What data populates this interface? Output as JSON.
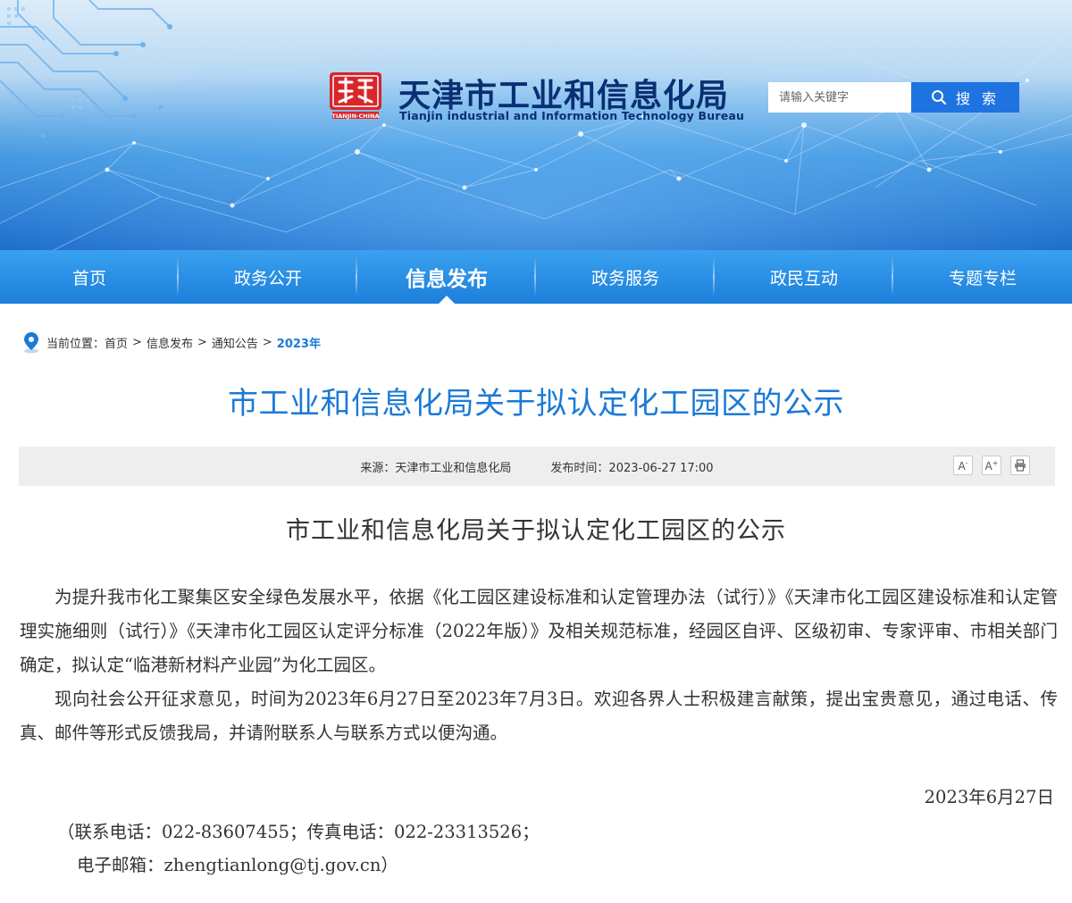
{
  "header": {
    "site_title": "天津市工业和信息化局",
    "site_subtitle": "Tianjin industrial and Information Technology Bureau",
    "logo_text": "天津",
    "logo_caption": "TIANJIN·CHINA",
    "search_placeholder": "请输入关键字",
    "search_button": "搜 索"
  },
  "nav": {
    "items": [
      {
        "label": "首页"
      },
      {
        "label": "政务公开"
      },
      {
        "label": "信息发布"
      },
      {
        "label": "政务服务"
      },
      {
        "label": "政民互动"
      },
      {
        "label": "专题专栏"
      }
    ],
    "active_label": "信息发布"
  },
  "breadcrumb": {
    "prefix": "当前位置：",
    "items": [
      "首页",
      "信息发布",
      "通知公告"
    ],
    "current": "2023年",
    "separator": ">"
  },
  "article": {
    "title": "市工业和信息化局关于拟认定化工园区的公示",
    "source": "来源：天津市工业和信息化局",
    "published": "发布时间：2023-06-27 17:00",
    "tools": {
      "font_smaller": "A",
      "font_larger": "A",
      "print": "print-icon"
    },
    "doc_title": "市工业和信息化局关于拟认定化工园区的公示",
    "paragraphs": [
      "为提升我市化工聚集区安全绿色发展水平，依据《化工园区建设标准和认定管理办法（试行）》《天津市化工园区建设标准和认定管理实施细则（试行）》《天津市化工园区认定评分标准（2022年版）》及相关规范标准，经园区自评、区级初审、专家评审、市相关部门确定，拟认定“临港新材料产业园”为化工园区。",
      "现向社会公开征求意见，时间为2023年6月27日至2023年7月3日。欢迎各界人士积极建言献策，提出宝贵意见，通过电话、传真、邮件等形式反馈我局，并请附联系人与联系方式以便沟通。"
    ],
    "date": "2023年6月27日",
    "contact_line1": "（联系电话：022-83607455；传真电话：022-23313526；",
    "contact_line2": "电子邮箱：zhengtianlong@tj.gov.cn）"
  },
  "colors": {
    "accent": "#1b7ad6",
    "nav_top": "#39a1ef",
    "nav_bottom": "#1c7fdb",
    "title_dark": "#0a2f73",
    "logo_red": "#d8262a"
  }
}
